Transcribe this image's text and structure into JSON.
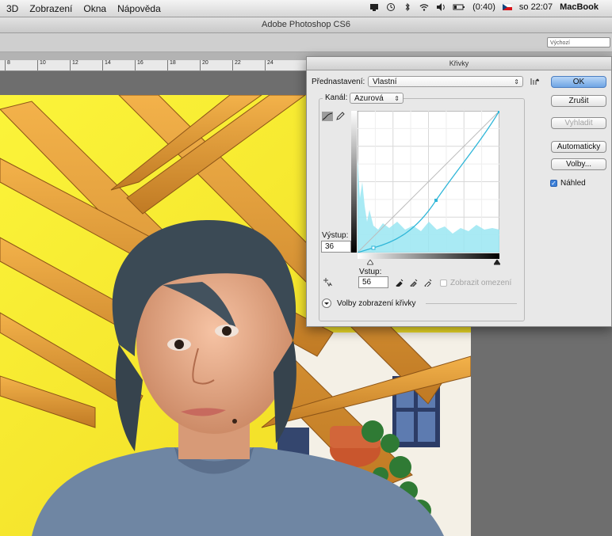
{
  "menubar": {
    "items": [
      "3D",
      "Zobrazení",
      "Okna",
      "Nápověda"
    ],
    "battery": "(0:40)",
    "clock": "so 22:07",
    "computer_name": "MacBook"
  },
  "app": {
    "title": "Adobe Photoshop CS6"
  },
  "options_bar": {
    "workspace": "Výchozí"
  },
  "ruler": {
    "ticks": [
      "8",
      "10",
      "12",
      "14",
      "16",
      "18",
      "20",
      "22",
      "24"
    ]
  },
  "curves_dialog": {
    "title": "Křivky",
    "preset_label": "Přednastavení:",
    "preset_value": "Vlastní",
    "channel_label": "Kanál:",
    "channel_value": "Azurová",
    "output_label": "Výstup:",
    "output_value": "36",
    "input_label": "Vstup:",
    "input_value": "56",
    "show_clipping_label": "Zobrazit omezení",
    "display_options_label": "Volby zobrazení křivky",
    "buttons": {
      "ok": "OK",
      "cancel": "Zrušit",
      "smooth": "Vyhladit",
      "auto": "Automaticky",
      "options": "Volby..."
    },
    "preview_label": "Náhled",
    "preview_checked": true,
    "curve_color": "#2fb6d8",
    "histogram_color": "#9ae6f2"
  }
}
